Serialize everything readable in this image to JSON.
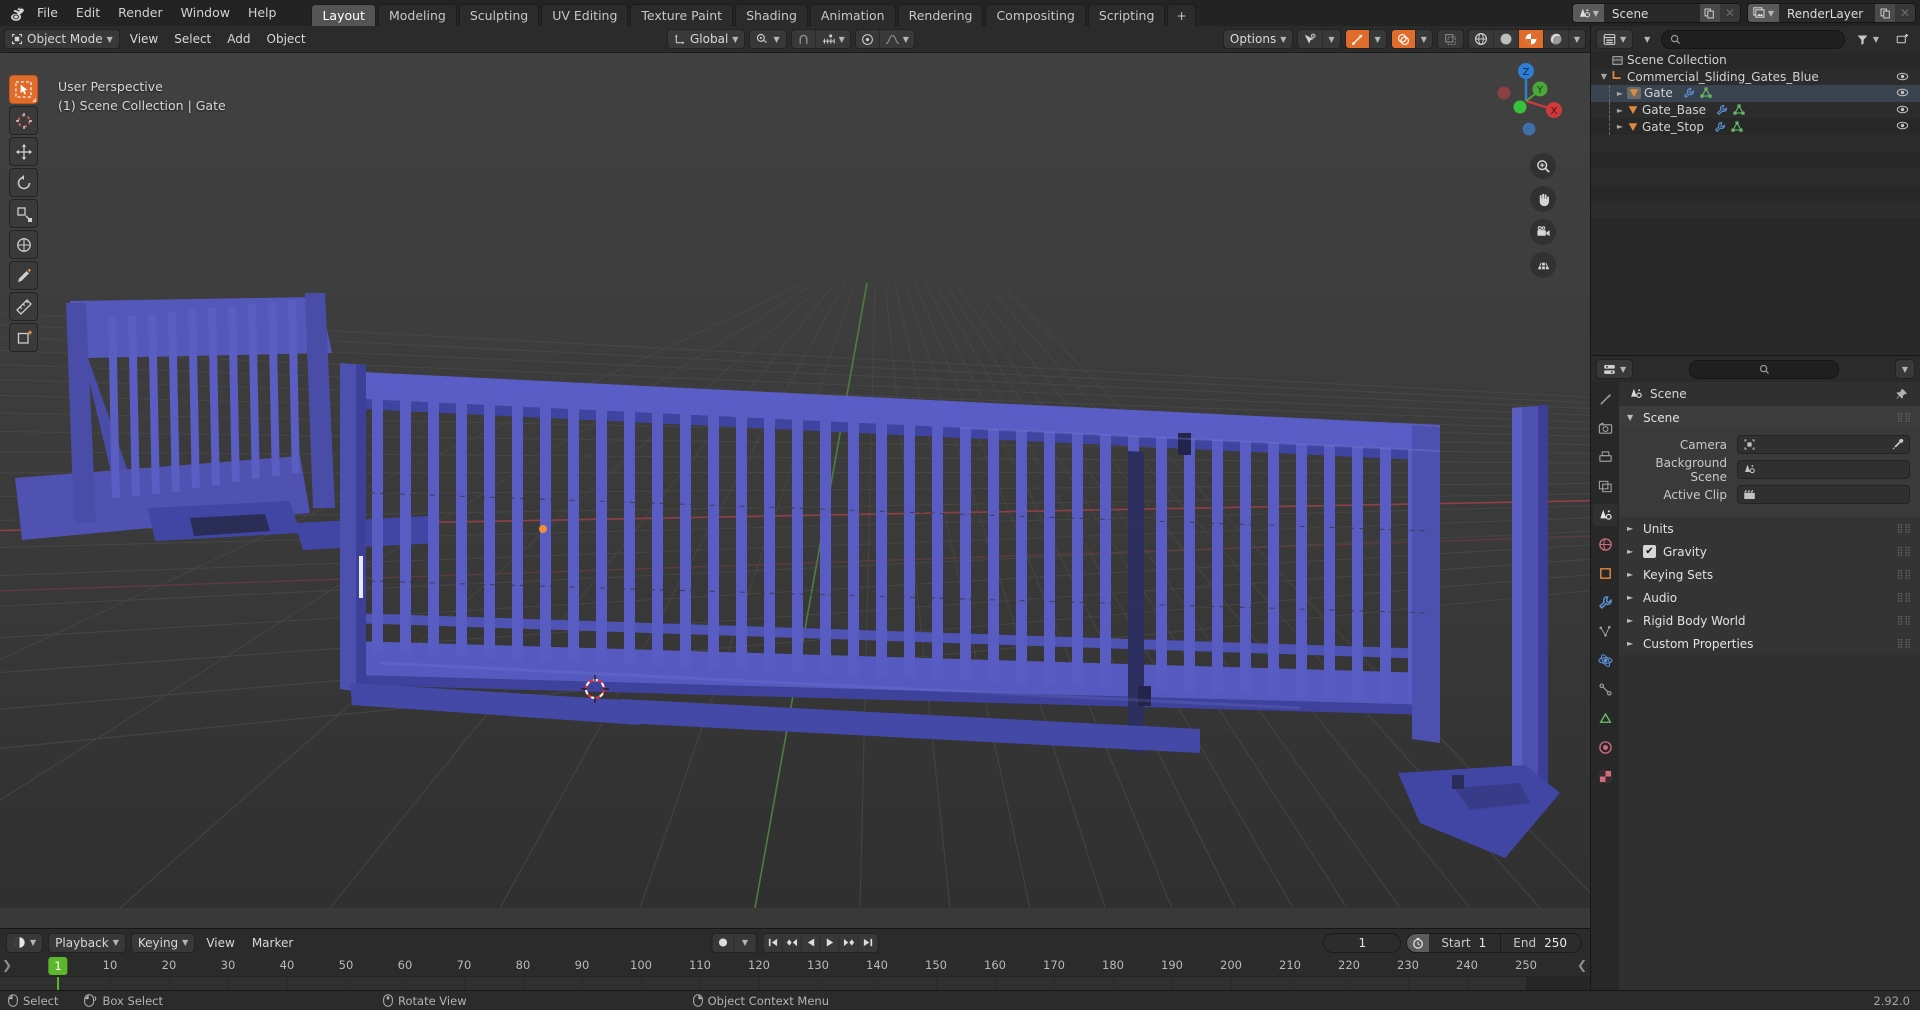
{
  "app": {
    "version": "2.92.0",
    "logo_icon": "blender-logo-icon"
  },
  "topbar": {
    "menus": [
      "File",
      "Edit",
      "Render",
      "Window",
      "Help"
    ],
    "workspace_tabs": [
      {
        "label": "Layout",
        "active": true
      },
      {
        "label": "Modeling",
        "active": false
      },
      {
        "label": "Sculpting",
        "active": false
      },
      {
        "label": "UV Editing",
        "active": false
      },
      {
        "label": "Texture Paint",
        "active": false
      },
      {
        "label": "Shading",
        "active": false
      },
      {
        "label": "Animation",
        "active": false
      },
      {
        "label": "Rendering",
        "active": false
      },
      {
        "label": "Compositing",
        "active": false
      },
      {
        "label": "Scripting",
        "active": false
      }
    ],
    "add_workspace_label": "+",
    "scene_datablock": {
      "icon": "scene-icon",
      "name": "Scene",
      "new_icon": "copy-icon",
      "unlink_icon": "x-icon"
    },
    "viewlayer_datablock": {
      "icon": "viewlayer-icon",
      "name": "RenderLayer",
      "new_icon": "copy-icon",
      "unlink_icon": "x-icon"
    }
  },
  "viewport": {
    "header": {
      "mode": "Object Mode",
      "menus": [
        "View",
        "Select",
        "Add",
        "Object"
      ],
      "transform_orientation": "Global",
      "pivot_icon": "pivot-icon",
      "snap_icon": "snap-magnet-icon",
      "snap_to_icon": "snap-increment-icon",
      "proportional_icon": "proportional-edit-icon",
      "proportional_falloff_icon": "falloff-curve-icon",
      "options_label": "Options",
      "visibility_icon": "visibility-arrow-icon",
      "gizmo_icon": "gizmo-icon",
      "overlays_icon": "overlays-icon",
      "xray_icon": "xray-icon",
      "shading_modes": [
        "wireframe-icon",
        "solid-icon",
        "material-preview-icon",
        "rendered-icon"
      ],
      "shading_active_index": 2
    },
    "overlay_text": {
      "view_name": "User Perspective",
      "collection_line": "(1) Scene Collection | Gate"
    },
    "toolbar_tools": [
      {
        "name": "tweak-select-tool",
        "active": true
      },
      {
        "name": "cursor-tool",
        "active": false
      },
      {
        "name": "move-tool",
        "active": false
      },
      {
        "name": "rotate-tool",
        "active": false
      },
      {
        "name": "scale-tool",
        "active": false
      },
      {
        "name": "transform-tool",
        "active": false
      },
      {
        "name": "annotate-tool",
        "active": false
      },
      {
        "name": "measure-tool",
        "active": false
      },
      {
        "name": "add-cube-tool",
        "active": false
      }
    ],
    "gizmo_axes": {
      "x": "X",
      "y": "Y",
      "z": "Z"
    },
    "nav_buttons": [
      "zoom-icon",
      "pan-hand-icon",
      "camera-icon",
      "ortho-persp-grid-icon"
    ],
    "colors": {
      "background_top": "#3d3d3d",
      "background_bottom": "#2f2f2f",
      "grid_line": "#4a4a4a",
      "axis_x": "#9a4a4e",
      "axis_y": "#4a7a3c",
      "model_blue": "#4a4dae",
      "model_blue_light": "#6164c4",
      "model_blue_dark": "#3a3d92"
    }
  },
  "outliner": {
    "display_mode_icon": "editor-type-icon",
    "filter_icon": "filter-icon",
    "search_placeholder": "",
    "rows": [
      {
        "name": "Scene Collection",
        "icon": "collection-icon",
        "indent": 0,
        "expanded": null,
        "selected": false,
        "visible": false,
        "sub_icons": []
      },
      {
        "name": "Commercial_Sliding_Gates_Blue",
        "icon": "collection-group-icon",
        "indent": 1,
        "expanded": true,
        "selected": false,
        "visible": true,
        "sub_icons": []
      },
      {
        "name": "Gate",
        "icon": "mesh-object-icon",
        "indent": 2,
        "expanded": false,
        "selected": true,
        "visible": true,
        "sub_icons": [
          "modifier-wrench-icon",
          "mesh-data-icon"
        ]
      },
      {
        "name": "Gate_Base",
        "icon": "mesh-object-icon",
        "indent": 2,
        "expanded": false,
        "selected": false,
        "visible": true,
        "sub_icons": [
          "modifier-wrench-icon",
          "mesh-data-icon"
        ]
      },
      {
        "name": "Gate_Stop",
        "icon": "mesh-object-icon",
        "indent": 2,
        "expanded": false,
        "selected": false,
        "visible": true,
        "sub_icons": [
          "modifier-wrench-icon",
          "mesh-data-icon"
        ]
      }
    ]
  },
  "properties": {
    "editor_icon": "properties-editor-icon",
    "search_placeholder": "",
    "dropdown_icon": "chevron-down-icon",
    "tabs": [
      {
        "name": "tool-tab",
        "icon": "wrench-screwdriver-icon",
        "active": false
      },
      {
        "name": "render-tab",
        "icon": "camera-back-icon",
        "active": false
      },
      {
        "name": "output-tab",
        "icon": "printer-icon",
        "active": false
      },
      {
        "name": "view-layer-tab",
        "icon": "images-icon",
        "active": false
      },
      {
        "name": "scene-tab",
        "icon": "scene-cone-icon",
        "active": true
      },
      {
        "name": "world-tab",
        "icon": "world-globe-icon",
        "active": false
      },
      {
        "name": "object-tab",
        "icon": "object-square-icon",
        "active": false
      },
      {
        "name": "modifier-tab",
        "icon": "wrench-icon",
        "active": false
      },
      {
        "name": "particles-tab",
        "icon": "particles-icon",
        "active": false
      },
      {
        "name": "physics-tab",
        "icon": "physics-orbit-icon",
        "active": false
      },
      {
        "name": "constraints-tab",
        "icon": "constraint-icon",
        "active": false
      },
      {
        "name": "data-tab",
        "icon": "mesh-data-triangle-icon",
        "active": false
      },
      {
        "name": "material-tab",
        "icon": "material-sphere-icon",
        "active": false
      },
      {
        "name": "texture-tab",
        "icon": "texture-checker-icon",
        "active": false
      }
    ],
    "breadcrumb": {
      "icon": "scene-cone-icon",
      "label": "Scene",
      "pin_icon": "pin-icon"
    },
    "panels": [
      {
        "title": "Scene",
        "open": true,
        "checkbox": null,
        "fields": [
          {
            "label": "Camera",
            "icon": "camera-object-icon",
            "value": "",
            "has_eyedropper": true
          },
          {
            "label": "Background Scene",
            "icon": "scene-cone-icon",
            "value": "",
            "has_eyedropper": false
          },
          {
            "label": "Active Clip",
            "icon": "clapperboard-icon",
            "value": "",
            "has_eyedropper": false
          }
        ]
      },
      {
        "title": "Units",
        "open": false,
        "checkbox": null,
        "fields": []
      },
      {
        "title": "Gravity",
        "open": false,
        "checkbox": true,
        "fields": []
      },
      {
        "title": "Keying Sets",
        "open": false,
        "checkbox": null,
        "fields": []
      },
      {
        "title": "Audio",
        "open": false,
        "checkbox": null,
        "fields": []
      },
      {
        "title": "Rigid Body World",
        "open": false,
        "checkbox": null,
        "fields": []
      },
      {
        "title": "Custom Properties",
        "open": false,
        "checkbox": null,
        "fields": []
      }
    ]
  },
  "timeline": {
    "editor_icon": "timeline-editor-icon",
    "menus": [
      "Playback",
      "Keying",
      "View",
      "Marker"
    ],
    "record_icon": "record-dot-icon",
    "transport_buttons": [
      "jump-start-icon",
      "prev-keyframe-icon",
      "play-reverse-icon",
      "play-icon",
      "next-keyframe-icon",
      "jump-end-icon"
    ],
    "current_frame": "1",
    "start_label": "Start",
    "start_value": "1",
    "end_label": "End",
    "end_value": "250",
    "clock_icon": "stopwatch-icon",
    "ruler_ticks": [
      "1",
      "10",
      "20",
      "30",
      "40",
      "50",
      "60",
      "70",
      "80",
      "90",
      "100",
      "110",
      "120",
      "130",
      "140",
      "150",
      "160",
      "170",
      "180",
      "190",
      "200",
      "210",
      "220",
      "230",
      "240",
      "250"
    ],
    "playhead_frame": "1",
    "playhead_color": "#5cb82a"
  },
  "statusbar": {
    "items": [
      {
        "icon": "mouse-left-icon",
        "label": "Select"
      },
      {
        "icon": "mouse-left-drag-icon",
        "label": "Box Select"
      },
      {
        "icon": "mouse-middle-icon",
        "label": "Rotate View"
      },
      {
        "icon": "mouse-right-icon",
        "label": "Object Context Menu"
      }
    ],
    "version": "2.92.0"
  }
}
